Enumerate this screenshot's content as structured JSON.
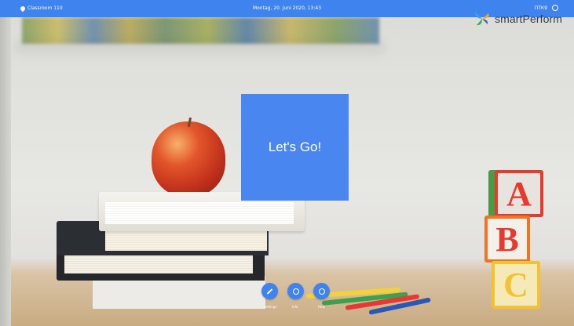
{
  "topbar": {
    "location": "Classroom 110",
    "datetime": "Montag, 20. Juni 2020, 13:43",
    "right_text": "ПТК9",
    "location_icon": "pin-icon",
    "settings_icon": "gear-icon"
  },
  "logo": {
    "text": "smartPerform"
  },
  "main": {
    "go_label": "Let's Go!"
  },
  "toolbar": {
    "buttons": [
      {
        "icon": "wrench-icon",
        "label": "Settings"
      },
      {
        "icon": "info-icon",
        "label": "Info"
      },
      {
        "icon": "help-icon",
        "label": "Help"
      }
    ]
  },
  "colors": {
    "accent": "#3f83ef",
    "tile": "#4a86f0"
  }
}
